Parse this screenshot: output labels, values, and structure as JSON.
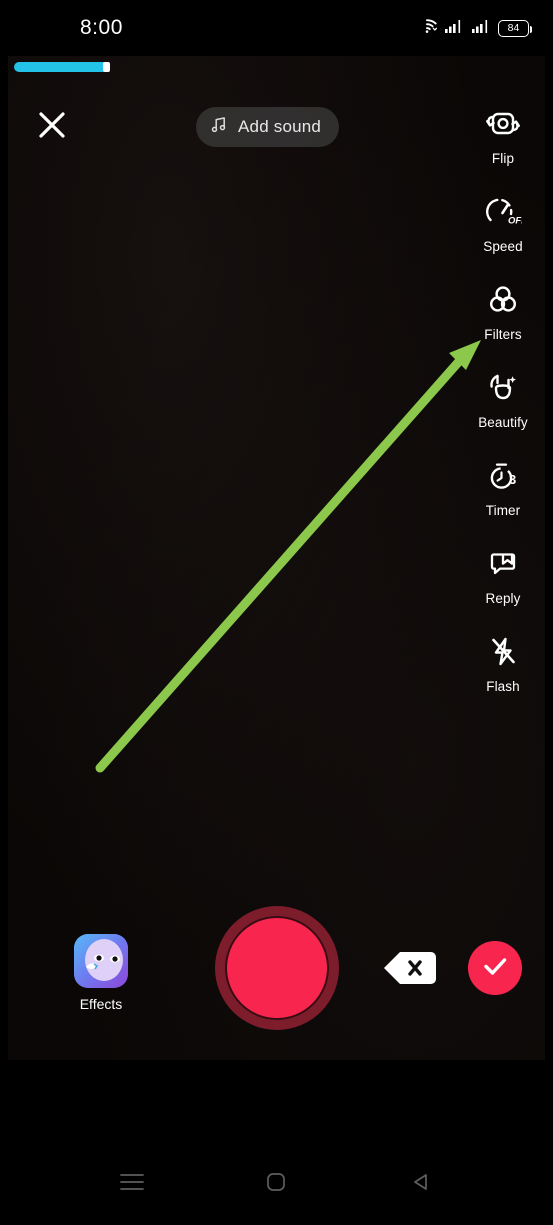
{
  "status_bar": {
    "time": "8:00",
    "wifi_icon": "wifi-icon",
    "signal_icon_1": "cellular-signal-icon",
    "signal_icon_2": "cellular-signal-icon",
    "battery_level": "84"
  },
  "recording": {
    "progress_percent": 18
  },
  "top_bar": {
    "close_icon": "close-icon",
    "add_sound_label": "Add sound",
    "music_note_icon": "music-note-icon"
  },
  "tool_rail": {
    "items": [
      {
        "label": "Flip",
        "icon": "camera-flip-icon"
      },
      {
        "label": "Speed",
        "icon": "speedometer-icon",
        "badge": "OFF"
      },
      {
        "label": "Filters",
        "icon": "filters-circles-icon"
      },
      {
        "label": "Beautify",
        "icon": "beautify-face-sparkle-icon"
      },
      {
        "label": "Timer",
        "icon": "timer-stopwatch-icon",
        "badge": "3"
      },
      {
        "label": "Reply",
        "icon": "reply-bubble-bookmark-icon"
      },
      {
        "label": "Flash",
        "icon": "flash-off-icon"
      }
    ]
  },
  "bottom_bar": {
    "effects_label": "Effects",
    "effects_icon": "effects-face-icon",
    "record_icon": "record-button-icon",
    "delete_icon": "backspace-delete-icon",
    "confirm_icon": "checkmark-icon"
  },
  "nav_bar": {
    "recents_icon": "menu-recents-icon",
    "home_icon": "home-square-icon",
    "back_icon": "back-triangle-icon"
  },
  "annotation": {
    "arrow_icon": "green-pointer-arrow",
    "color": "#8cc84b",
    "points_at": "Filters"
  },
  "colors": {
    "accent_record": "#f8264f",
    "progress": "#22c3e6",
    "annotation_green": "#8cc84b",
    "background": "#000000"
  }
}
